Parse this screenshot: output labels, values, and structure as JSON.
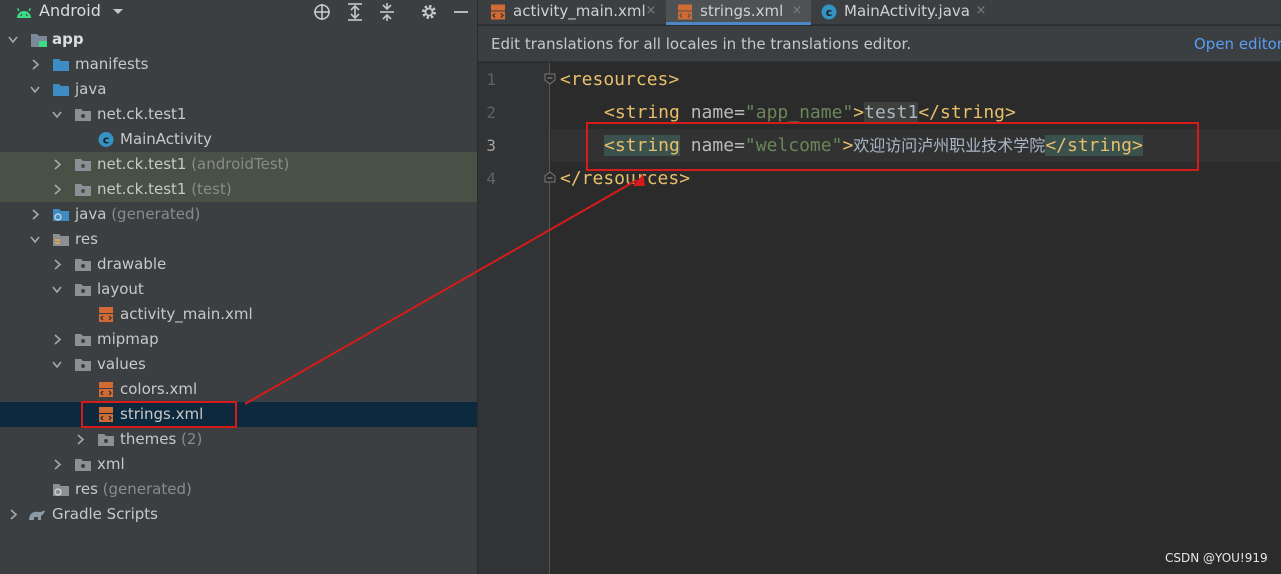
{
  "project_panel": {
    "title": "Android",
    "tree": [
      {
        "label": "app",
        "suffix": "",
        "icon": "module-folder-icon"
      },
      {
        "label": "manifests",
        "suffix": "",
        "icon": "folder-icon"
      },
      {
        "label": "java",
        "suffix": "",
        "icon": "folder-icon"
      },
      {
        "label": "net.ck.test1",
        "suffix": "",
        "icon": "package-icon"
      },
      {
        "label": "MainActivity",
        "suffix": "",
        "icon": "class-icon"
      },
      {
        "label": "net.ck.test1",
        "suffix": " (androidTest)",
        "icon": "package-icon"
      },
      {
        "label": "net.ck.test1",
        "suffix": " (test)",
        "icon": "package-icon"
      },
      {
        "label": "java",
        "suffix": " (generated)",
        "icon": "generated-folder-icon"
      },
      {
        "label": "res",
        "suffix": "",
        "icon": "resource-folder-icon"
      },
      {
        "label": "drawable",
        "suffix": "",
        "icon": "package-icon"
      },
      {
        "label": "layout",
        "suffix": "",
        "icon": "package-icon"
      },
      {
        "label": "activity_main.xml",
        "suffix": "",
        "icon": "xml-file-icon"
      },
      {
        "label": "mipmap",
        "suffix": "",
        "icon": "package-icon"
      },
      {
        "label": "values",
        "suffix": "",
        "icon": "package-icon"
      },
      {
        "label": "colors.xml",
        "suffix": "",
        "icon": "xml-file-icon"
      },
      {
        "label": "strings.xml",
        "suffix": "",
        "icon": "xml-file-icon"
      },
      {
        "label": "themes",
        "suffix": " (2)",
        "icon": "package-icon"
      },
      {
        "label": "xml",
        "suffix": "",
        "icon": "package-icon"
      },
      {
        "label": "res",
        "suffix": " (generated)",
        "icon": "generated-folder-icon"
      },
      {
        "label": "Gradle Scripts",
        "suffix": "",
        "icon": "gradle-icon"
      }
    ]
  },
  "tabs": [
    {
      "label": "activity_main.xml",
      "close": "×"
    },
    {
      "label": "strings.xml",
      "close": "×"
    },
    {
      "label": "MainActivity.java",
      "close": "×"
    }
  ],
  "banner": {
    "text": "Edit translations for all locales in the translations editor.",
    "link": "Open editor"
  },
  "editor": {
    "line_numbers": [
      "1",
      "2",
      "3",
      "4"
    ],
    "lines": [
      {
        "open": "<resources>"
      },
      {
        "open": "<string",
        "attr": "name",
        "eq": "=",
        "val": "\"app_name\"",
        "gt": ">",
        "text": "test1",
        "close": "</string>"
      },
      {
        "open": "<string",
        "attr": "name",
        "eq": "=",
        "val": "\"welcome\"",
        "gt": ">",
        "text": "欢迎访问泸州职业技术学院",
        "close": "</string>"
      },
      {
        "open": "</resources>"
      }
    ]
  },
  "watermark": "CSDN @YOU!919",
  "colors": {
    "annotation_red": "#d71a1a",
    "tag": "#e8bf6a",
    "value": "#6a8759",
    "selection": "#0d293e",
    "test_highlight": "#475145"
  }
}
